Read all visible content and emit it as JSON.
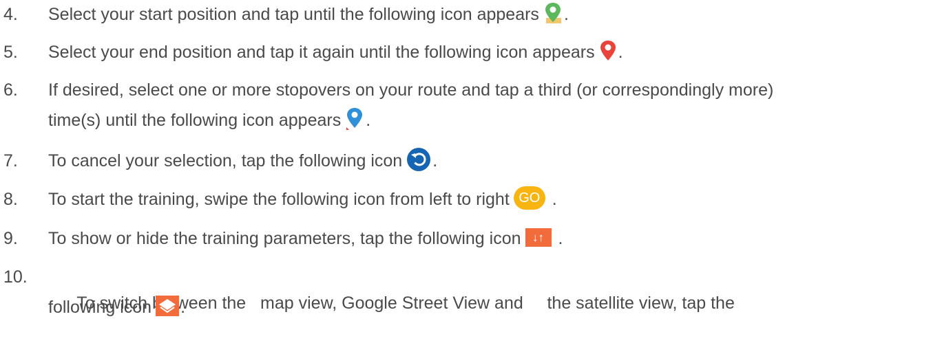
{
  "items": [
    {
      "number": "4.",
      "text": "Select your start position and tap until the following icon appears",
      "icon": "green-pin-icon",
      "suffix": "."
    },
    {
      "number": "5.",
      "text": "Select your end position and tap it again until the following icon appears",
      "icon": "red-pin-icon",
      "suffix": "."
    },
    {
      "number": "6.",
      "text_line1": "If desired, select one or more stopovers on your route and tap a third (or correspondingly more)",
      "text_line2": "time(s) until the following icon appears",
      "icon": "blue-pin-icon",
      "suffix": "."
    },
    {
      "number": "7.",
      "text": "To cancel your selection, tap the following icon",
      "icon": "undo-icon",
      "suffix": "."
    },
    {
      "number": "8.",
      "text": "To start the training, swipe the following icon from left to right",
      "icon": "go-button-icon",
      "icon_label": "GO",
      "suffix": "."
    },
    {
      "number": "9.",
      "text": "To show or hide the training parameters, tap the following icon",
      "icon": "show-hide-parameters-icon",
      "icon_label": "↓↑",
      "suffix": "."
    },
    {
      "number": "10.",
      "text_line1": "To switch between the   map view, Google Street View and     the satellite view, tap the",
      "text_line2": "following icon",
      "icon": "layers-icon",
      "suffix": "."
    }
  ],
  "colors": {
    "text": "#4a4a4a",
    "green_pin": "#5cb85c",
    "red_pin": "#e8443a",
    "blue_pin": "#2f8fd8",
    "undo": "#1565b3",
    "go": "#f8b511",
    "params": "#f26b3a",
    "layers": "#f26b3a"
  }
}
